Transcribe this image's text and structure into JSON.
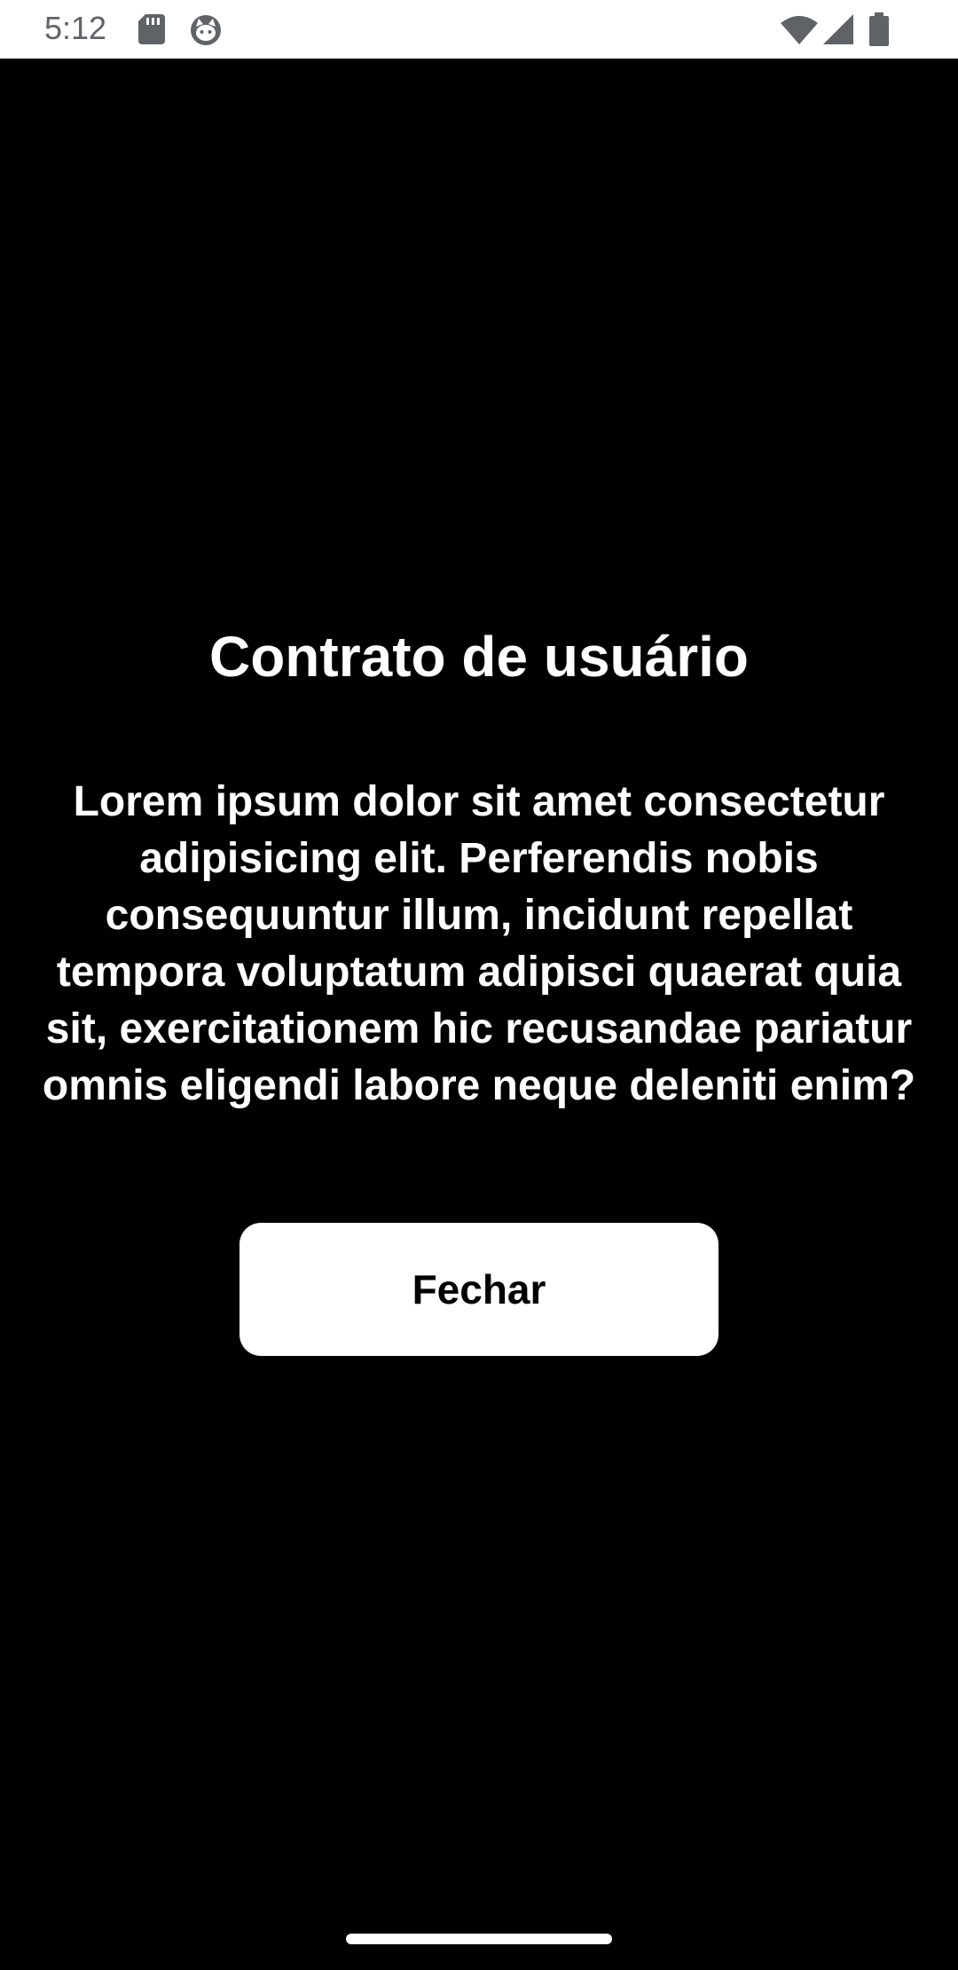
{
  "status_bar": {
    "time": "5:12",
    "icons": [
      "sd-card-icon",
      "cat-icon",
      "wifi-icon",
      "cell-signal-icon",
      "battery-icon"
    ]
  },
  "dialog": {
    "title": "Contrato de usuário",
    "body": "Lorem ipsum dolor sit amet consectetur adipisicing elit. Perferendis nobis consequuntur illum, incidunt repellat tempora voluptatum adipisci quaerat quia sit, exercitationem hic recusandae pariatur omnis eligendi labore neque deleniti enim?",
    "close_label": "Fechar"
  },
  "colors": {
    "background": "#000000",
    "text": "#ffffff",
    "button_bg": "#ffffff",
    "button_text": "#000000",
    "status_bar_bg": "#ffffff",
    "status_icons": "#5f6368"
  }
}
